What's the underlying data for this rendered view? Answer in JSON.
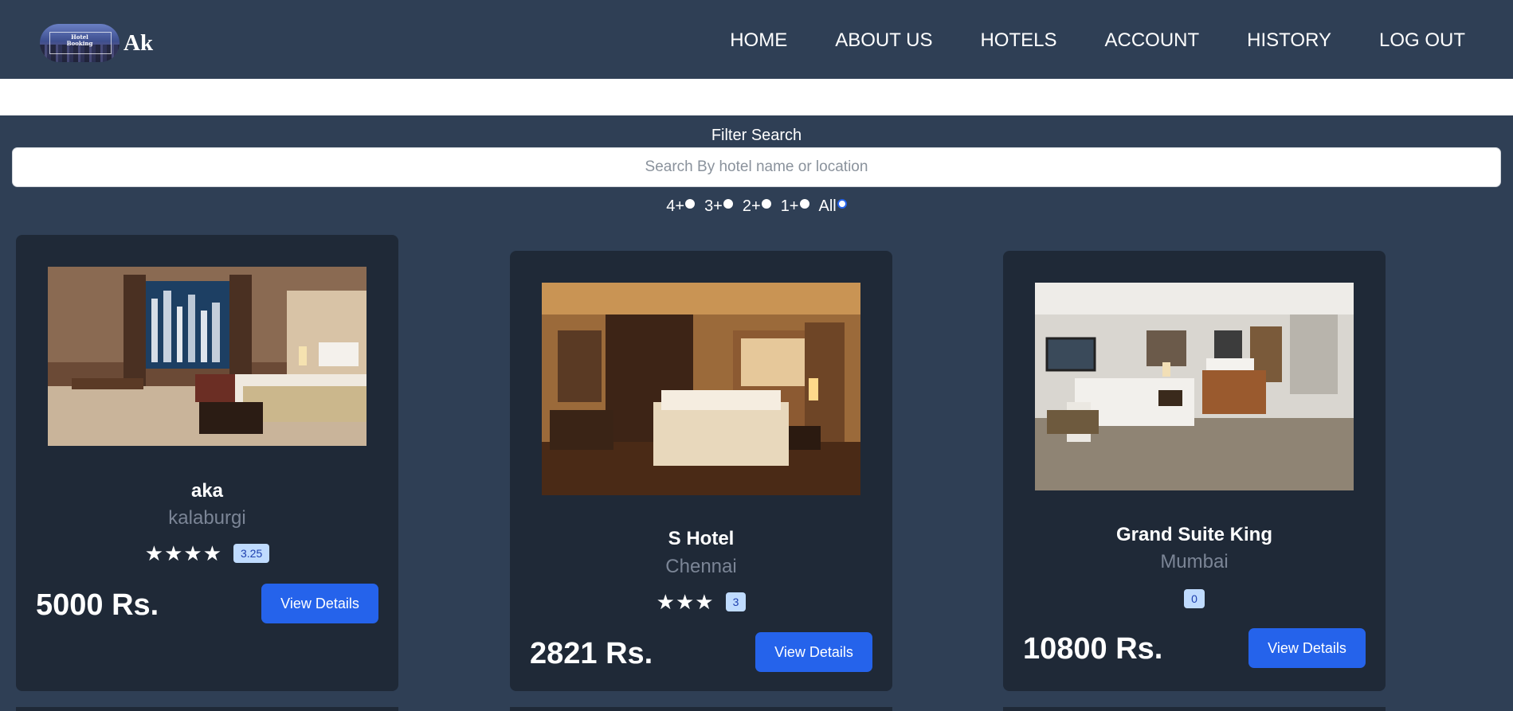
{
  "header": {
    "logo_text_line1": "Hotel",
    "logo_text_line2": "Booking",
    "brand": "Ak",
    "nav": [
      "HOME",
      "ABOUT US",
      "HOTELS",
      "ACCOUNT",
      "HISTORY",
      "LOG OUT"
    ]
  },
  "filter": {
    "label": "Filter Search",
    "search_placeholder": "Search By hotel name or location",
    "search_value": "",
    "ratings": [
      {
        "label": "4+",
        "selected": false
      },
      {
        "label": "3+",
        "selected": false
      },
      {
        "label": "2+",
        "selected": false
      },
      {
        "label": "1+",
        "selected": false
      },
      {
        "label": "All",
        "selected": true
      }
    ]
  },
  "hotels": [
    {
      "name": "aka",
      "location": "kalaburgi",
      "stars": 4,
      "rating": "3.25",
      "price": "5000 Rs.",
      "button": "View Details"
    },
    {
      "name": "S Hotel",
      "location": "Chennai",
      "stars": 3,
      "rating": "3",
      "price": "2821 Rs.",
      "button": "View Details"
    },
    {
      "name": "Grand Suite King",
      "location": "Mumbai",
      "stars": 0,
      "rating": "0",
      "price": "10800 Rs.",
      "button": "View Details"
    }
  ],
  "colors": {
    "background": "#2f3f55",
    "card": "#1f2937",
    "accent_button": "#2563eb",
    "badge_bg": "#bfdbfe",
    "badge_text": "#1e40af"
  },
  "icons": {
    "star": "star-icon"
  }
}
